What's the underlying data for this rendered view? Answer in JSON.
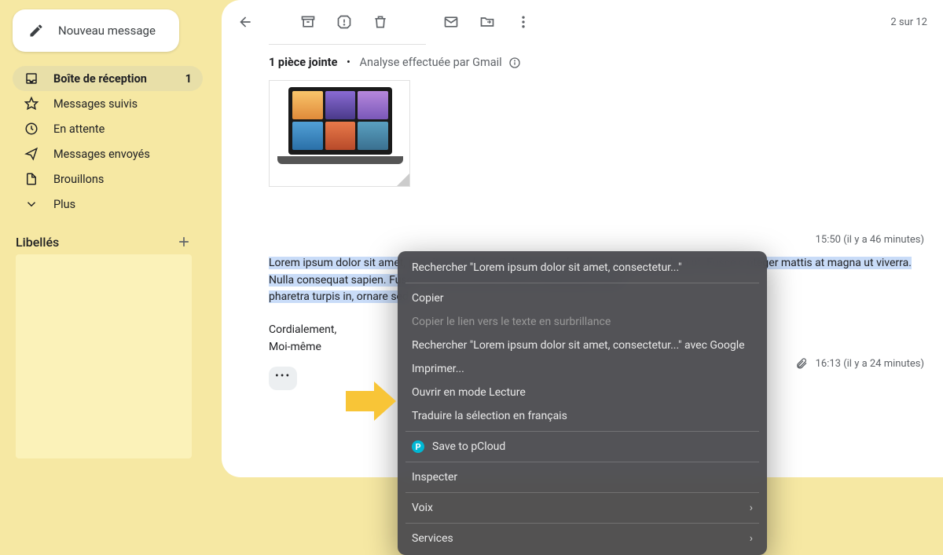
{
  "compose_label": "Nouveau message",
  "nav": [
    {
      "icon": "inbox",
      "label": "Boîte de réception",
      "count": "1",
      "active": true
    },
    {
      "icon": "star",
      "label": "Messages suivis"
    },
    {
      "icon": "clock",
      "label": "En attente"
    },
    {
      "icon": "send",
      "label": "Messages envoyés"
    },
    {
      "icon": "file",
      "label": "Brouillons"
    },
    {
      "icon": "chevron",
      "label": "Plus"
    }
  ],
  "labels_header": "Libellés",
  "toolbar_count": "2 sur 12",
  "attachment_title": "1 pièce jointe",
  "attachment_sub": "Analyse effectuée par Gmail",
  "timestamp1": "15:50 (il y a 46 minutes)",
  "body_highlighted": "Lorem ipsum dolor sit amet,                                                                                                                                                       per sit amet dolor. Pellentesque faucibus urna vestibulum ut. Fusce c                                                                                                                                                   nteger mattis at magna ut viverra. Nulla consequat sapien. Fusce a                                                                                                                                                    aretra sit amet velit in malesuada. Sed s",
  "body_line4": "pharetra turpis in, ornare sed",
  "sign1": "Cordialement,",
  "sign2": "Moi-même",
  "timestamp2": "16:13 (il y a 24 minutes)",
  "context_menu": [
    {
      "type": "item",
      "label": "Rechercher \"Lorem ipsum dolor sit amet, consectetur...\""
    },
    {
      "type": "divider"
    },
    {
      "type": "item",
      "label": "Copier"
    },
    {
      "type": "item",
      "label": "Copier le lien vers le texte en surbrillance",
      "disabled": true
    },
    {
      "type": "item",
      "label": "Rechercher \"Lorem ipsum dolor sit amet, consectetur...\" avec Google"
    },
    {
      "type": "item",
      "label": "Imprimer..."
    },
    {
      "type": "item",
      "label": "Ouvrir en mode Lecture"
    },
    {
      "type": "item",
      "label": "Traduire la sélection en français"
    },
    {
      "type": "divider"
    },
    {
      "type": "item",
      "label": "Save to pCloud",
      "icon": "pcloud"
    },
    {
      "type": "divider"
    },
    {
      "type": "item",
      "label": "Inspecter"
    },
    {
      "type": "divider"
    },
    {
      "type": "item",
      "label": "Voix",
      "submenu": true
    },
    {
      "type": "divider"
    },
    {
      "type": "item",
      "label": "Services",
      "submenu": true
    }
  ]
}
